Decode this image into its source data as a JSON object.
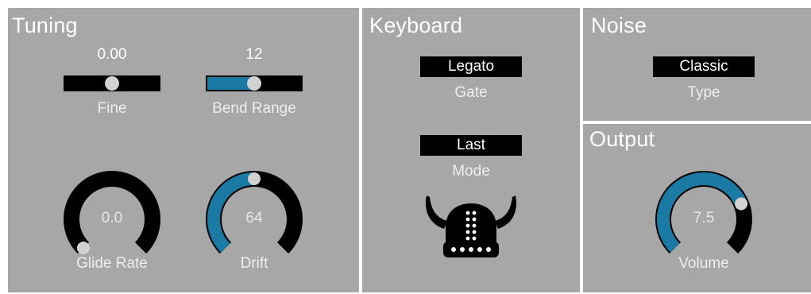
{
  "colors": {
    "background": "#a7a7a7",
    "divider": "#ffffff",
    "accent": "#1b7aa3",
    "track": "#000000",
    "handle": "#d2d2d2"
  },
  "tuning": {
    "title": "Tuning",
    "fine": {
      "value": "0.00",
      "label": "Fine",
      "level": 0.5
    },
    "bend_range": {
      "value": "12",
      "label": "Bend Range",
      "level": 0.5
    },
    "glide_rate": {
      "value": "0.0",
      "label": "Glide Rate",
      "level": 0.0
    },
    "drift": {
      "value": "64",
      "label": "Drift",
      "level": 0.5
    }
  },
  "keyboard": {
    "title": "Keyboard",
    "gate": {
      "selected": "Legato",
      "label": "Gate"
    },
    "mode": {
      "selected": "Last",
      "label": "Mode"
    },
    "logo_icon": "viking-helmet-icon"
  },
  "noise": {
    "title": "Noise",
    "type": {
      "selected": "Classic",
      "label": "Type"
    }
  },
  "output": {
    "title": "Output",
    "volume": {
      "value": "7.5",
      "label": "Volume",
      "level": 0.75
    }
  }
}
